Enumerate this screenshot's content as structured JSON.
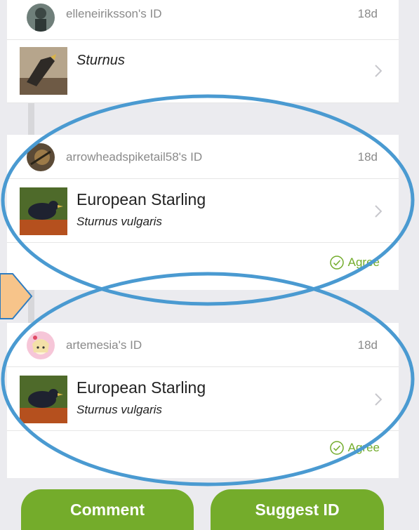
{
  "identifications": [
    {
      "username": "elleneiriksson's ID",
      "age": "18d",
      "avatar_icon": "user-avatar-icon",
      "taxon": {
        "common_name": "",
        "scientific_name": "Sturnus"
      },
      "agree_label": ""
    },
    {
      "username": "arrowheadspiketail58's ID",
      "age": "18d",
      "avatar_icon": "user-avatar-icon",
      "taxon": {
        "common_name": "European Starling",
        "scientific_name": "Sturnus vulgaris"
      },
      "agree_label": "Agree"
    },
    {
      "username": "artemesia's ID",
      "age": "18d",
      "avatar_icon": "user-avatar-icon",
      "taxon": {
        "common_name": "European Starling",
        "scientific_name": "Sturnus vulgaris"
      },
      "agree_label": "Agree"
    }
  ],
  "actions": {
    "comment_label": "Comment",
    "suggest_label": "Suggest ID"
  },
  "colors": {
    "accent_green": "#74ac2b",
    "highlight_ellipse": "#4a9ad1",
    "pointer_arrow": "#f7c48a",
    "background": "#ebebef"
  },
  "icons": [
    "chevron-right-icon",
    "agree-check-icon",
    "user-avatar-icon",
    "bird-photo-icon"
  ]
}
